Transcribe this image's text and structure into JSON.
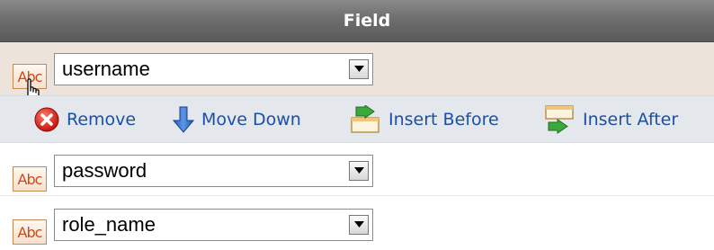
{
  "header": {
    "title": "Field"
  },
  "field_rows": [
    {
      "icon": "abc-text-icon",
      "icon_label": "Abc",
      "value": "username"
    },
    {
      "icon": "abc-text-icon",
      "icon_label": "Abc",
      "value": "password"
    },
    {
      "icon": "abc-text-icon",
      "icon_label": "Abc",
      "value": "role_name"
    }
  ],
  "actions": {
    "remove": {
      "label": "Remove",
      "icon": "remove-icon"
    },
    "move_down": {
      "label": "Move Down",
      "icon": "arrow-down-icon"
    },
    "insert_before": {
      "label": "Insert Before",
      "icon": "insert-before-icon"
    },
    "insert_after": {
      "label": "Insert After",
      "icon": "insert-after-icon"
    }
  },
  "colors": {
    "header_bg": "#6e6e6e",
    "selected_row_bg": "#ece4db",
    "action_row_bg": "#e4e8ed",
    "link_text": "#1a50a8"
  }
}
